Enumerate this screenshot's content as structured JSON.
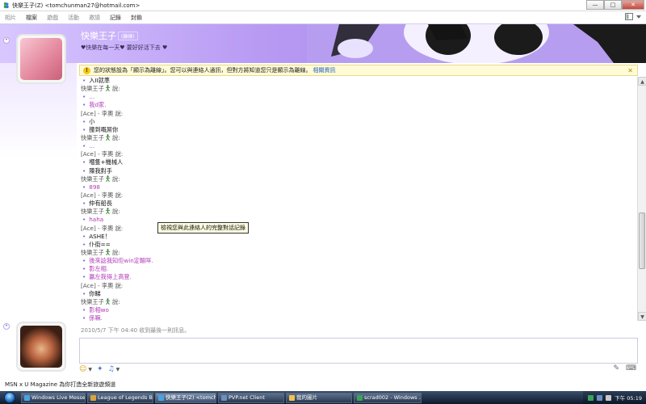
{
  "window": {
    "title": "快樂王子(Z) <tomchunman27@hotmail.com>",
    "minimize": "—",
    "maximize": "□",
    "close": "✕"
  },
  "menu": [
    "相片",
    "檔案",
    "遊戲",
    "活動",
    "邀請",
    "記錄",
    "封鎖"
  ],
  "menu_active_index": 1,
  "header": {
    "contact_name": "快樂王子",
    "contact_status": "(離線)",
    "personal_message": "♥快樂在每一天♥ 要好好活下去 ♥"
  },
  "infobar": {
    "text": "您的狀態設為「顯示為離線」。您可以與連絡人通訊，但對方將知道您只是顯示為離線。",
    "link": "相關資訊"
  },
  "conversation": [
    {
      "type": "msg",
      "who": "them",
      "text": "入II就準"
    },
    {
      "type": "sender",
      "text": "快樂王子",
      "emo": true,
      "suffix": " 說:"
    },
    {
      "type": "msg",
      "who": "me",
      "text": "..."
    },
    {
      "type": "msg",
      "who": "me",
      "text": "我d家."
    },
    {
      "type": "sender",
      "text": "[Ace] - 李奧",
      "emo": false,
      "suffix": " 說:"
    },
    {
      "type": "msg",
      "who": "them",
      "text": "小"
    },
    {
      "type": "msg",
      "who": "them",
      "text": "撞到嘅屌你"
    },
    {
      "type": "sender",
      "text": "快樂王子",
      "emo": true,
      "suffix": " 說:"
    },
    {
      "type": "msg",
      "who": "me",
      "text": "..."
    },
    {
      "type": "sender",
      "text": "[Ace] - 李奧",
      "emo": false,
      "suffix": " 說:"
    },
    {
      "type": "msg",
      "who": "them",
      "text": "嗰隻+機械人"
    },
    {
      "type": "msg",
      "who": "them",
      "text": "陳我對手"
    },
    {
      "type": "sender",
      "text": "快樂王子",
      "emo": true,
      "suffix": " 說:"
    },
    {
      "type": "msg",
      "who": "me",
      "text": "898"
    },
    {
      "type": "sender",
      "text": "[Ace] - 李奧",
      "emo": false,
      "suffix": " 說:"
    },
    {
      "type": "msg",
      "who": "them",
      "text": "仲有船長"
    },
    {
      "type": "sender",
      "text": "快樂王子",
      "emo": true,
      "suffix": " 說:"
    },
    {
      "type": "msg",
      "who": "me",
      "text": "haha"
    },
    {
      "type": "sender",
      "text": "[Ace] - 李奧",
      "emo": false,
      "suffix": " 說:"
    },
    {
      "type": "msg",
      "who": "them",
      "text": "ASHE！"
    },
    {
      "type": "msg",
      "who": "them",
      "text": "仆街=="
    },
    {
      "type": "sender",
      "text": "快樂王子",
      "emo": true,
      "suffix": " 說:"
    },
    {
      "type": "msg",
      "who": "me",
      "text": "後來諗我知佢win定輸咩."
    },
    {
      "type": "msg",
      "who": "me",
      "text": "影左相."
    },
    {
      "type": "msg",
      "who": "me",
      "text": "贏左我得上高登."
    },
    {
      "type": "sender",
      "text": "[Ace] - 李奧",
      "emo": false,
      "suffix": " 說:"
    },
    {
      "type": "msg",
      "who": "them",
      "text": "你睇"
    },
    {
      "type": "sender",
      "text": "快樂王子",
      "emo": true,
      "suffix": " 說:"
    },
    {
      "type": "msg",
      "who": "me",
      "text": "影相wo"
    },
    {
      "type": "msg",
      "who": "me",
      "text": "係嘛."
    }
  ],
  "tooltip": "檢視您與此連絡人的完整對話記錄",
  "last_message": "2010/5/7 下午 04:40 收到最後一則訊息。",
  "ad": "MSN x U Magazine 為你打造全新旅遊頻道",
  "input_toolbar": {
    "emoticon": "☺",
    "winks": "✦",
    "nudge": "♫",
    "handwrite": "✎",
    "keyboard": "⌨"
  },
  "taskbar": {
    "tasks": [
      {
        "label": "Windows Live Messe...",
        "color": "#4aa3df"
      },
      {
        "label": "League of Legends B...",
        "color": "#d9a23a"
      },
      {
        "label": "快樂王子(Z) <tomch...",
        "color": "#4aa3df"
      },
      {
        "label": "PVP.net Client",
        "color": "#6b8fbf"
      },
      {
        "label": "我的圖片",
        "color": "#f2c14e"
      },
      {
        "label": "scrad002 - Windows ...",
        "color": "#3aa35a"
      }
    ],
    "active_index": 2,
    "clock": "下午 05:19"
  },
  "colors": {
    "header_start": "#d8c7ff",
    "header_end": "#9e7be8",
    "my_text": "#b13ab8",
    "link": "#1f5fbf"
  }
}
